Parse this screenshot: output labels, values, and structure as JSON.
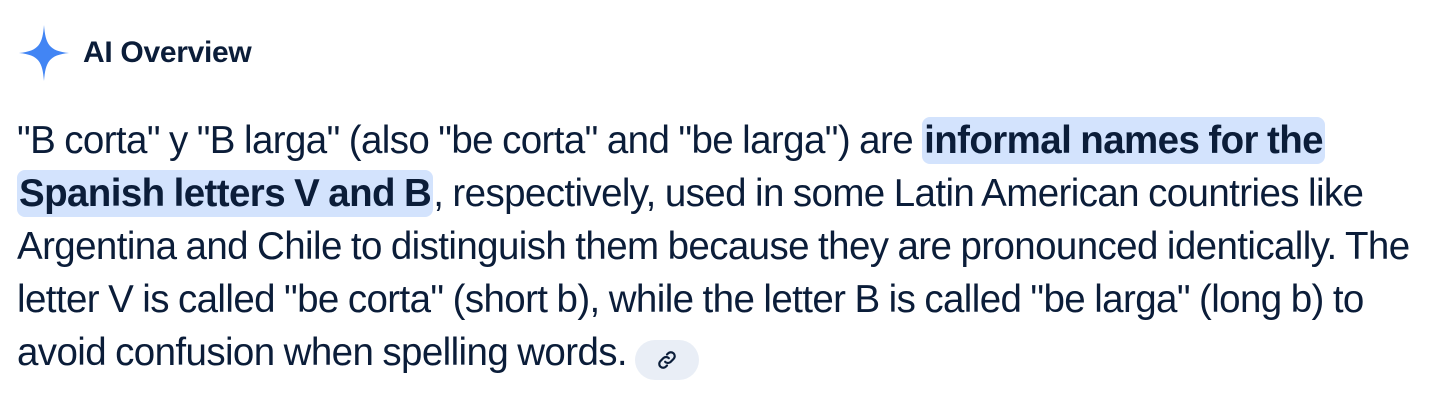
{
  "header": {
    "title": "AI Overview",
    "icon": "gemini-spark-icon",
    "icon_color": "#4285f4"
  },
  "answer": {
    "text_before": "\"B corta\" y \"B larga\" (also \"be corta\" and \"be larga\") are ",
    "highlight": "informal names for the Spanish letters V and B",
    "text_after": ", respectively, used in some Latin American countries like Argentina and Chile to distinguish them because they are pronounced identically. The letter V is called \"be corta\" (short b), while the letter B is called \"be larga\" (long b) to avoid confusion when spelling words.",
    "highlight_color": "#d3e3fd",
    "link_icon": "link-icon"
  }
}
